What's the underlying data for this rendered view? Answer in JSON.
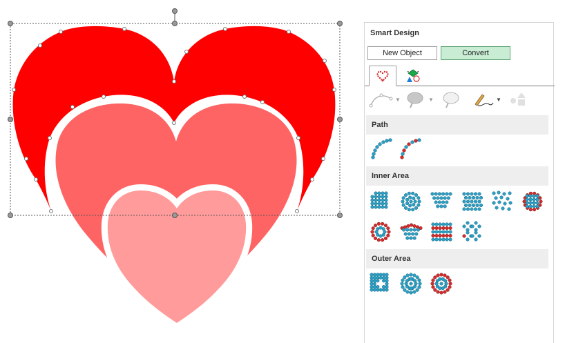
{
  "panel": {
    "title": "Smart Design",
    "new_object_label": "New Object",
    "convert_label": "Convert",
    "tabs": [
      {
        "icon": "heart-outline-icon",
        "active": true
      },
      {
        "icon": "shapes-icon",
        "active": false
      }
    ],
    "toolbar": [
      {
        "icon": "bezier-path-icon",
        "dropdown": true
      },
      {
        "icon": "brush-fill-icon",
        "dropdown": true
      },
      {
        "icon": "brush-outline-icon",
        "dropdown": false
      },
      {
        "icon": "pencil-line-icon",
        "dropdown": true
      },
      {
        "icon": "shape-tool-icon",
        "dropdown": false
      }
    ],
    "sections": [
      {
        "title": "Path",
        "tiles": [
          "path-single-icon",
          "path-dual-icon"
        ]
      },
      {
        "title": "Inner Area",
        "tiles": [
          "fill-grid-icon",
          "fill-concentric-icon",
          "fill-fan-icon",
          "fill-offset-grid-icon",
          "fill-random-icon",
          "fill-mixed-grid-icon",
          "fill-rings-icon",
          "fill-arc-icon",
          "fill-stripes-icon",
          "fill-diamonds-icon"
        ]
      },
      {
        "title": "Outer Area",
        "tiles": [
          "outer-star-icon",
          "outer-target-icon",
          "outer-rings-icon"
        ]
      }
    ]
  },
  "colors": {
    "heart_large": "#ff0000",
    "heart_medium": "#ff6464",
    "heart_small": "#ff9b9b",
    "rhinestone_blue": "#2aa0c6",
    "rhinestone_red": "#d62b2b",
    "convert_bg": "#c8ecd4"
  }
}
